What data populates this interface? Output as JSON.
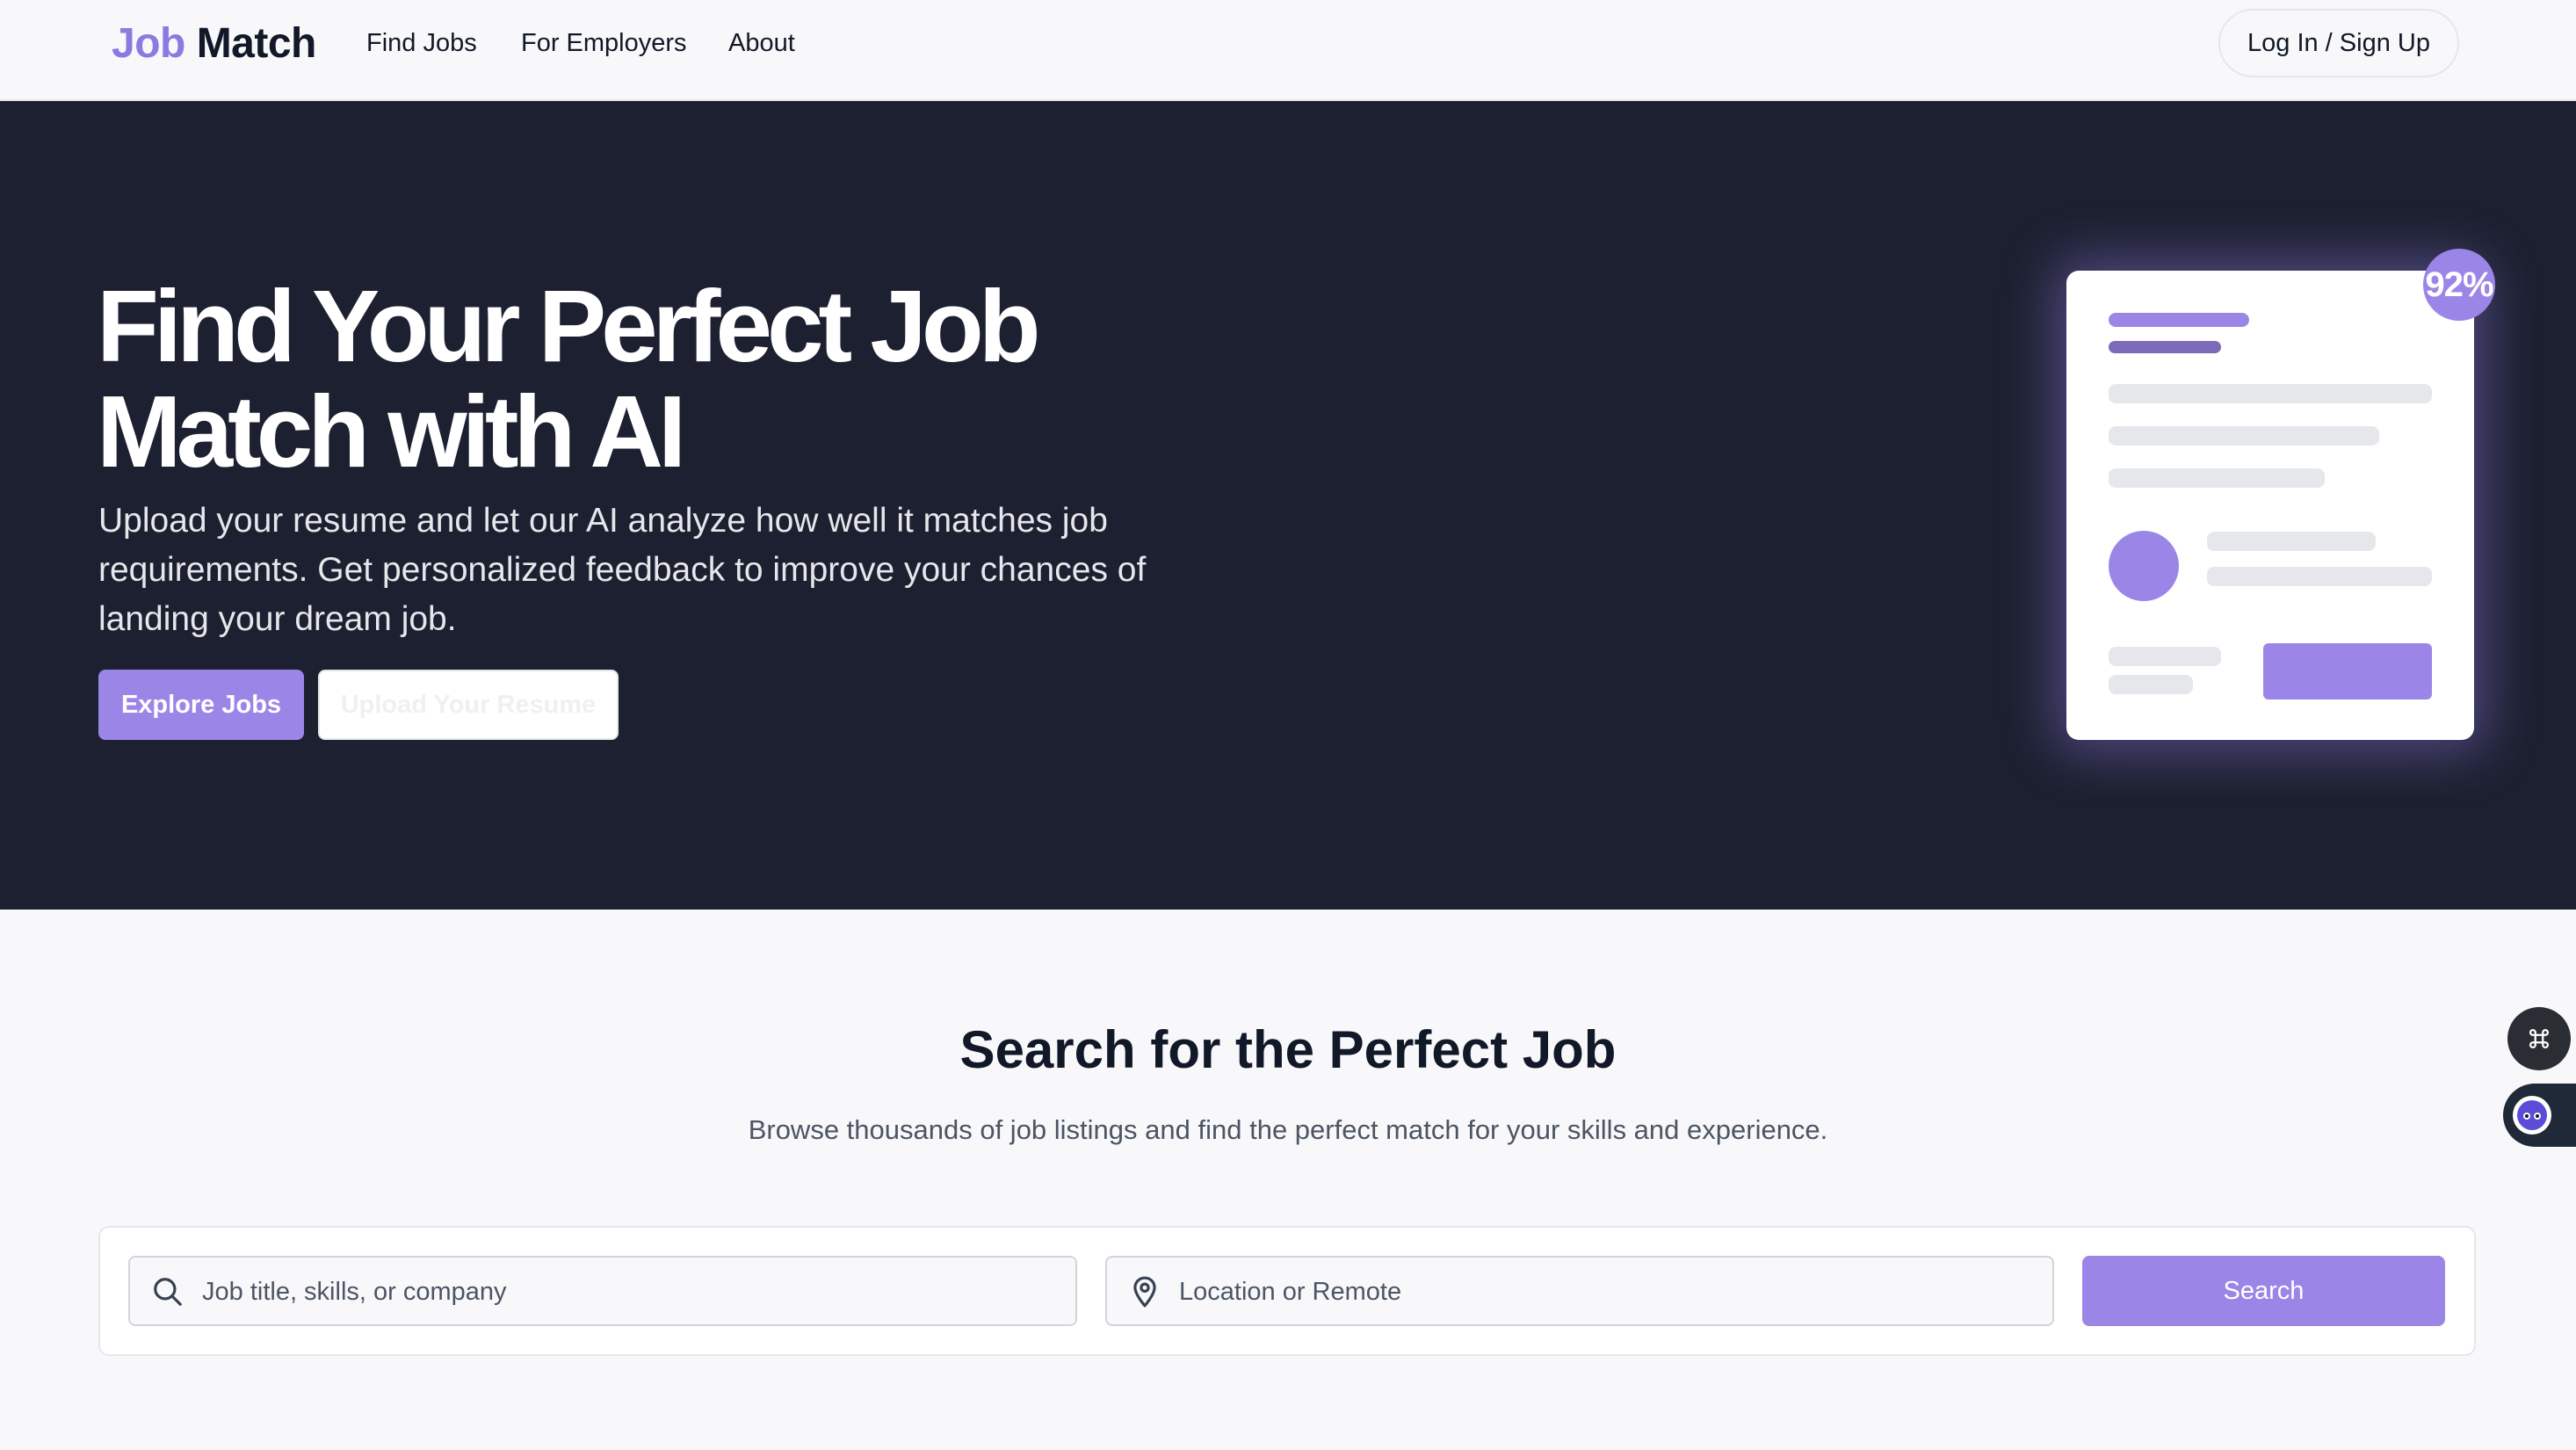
{
  "brand": {
    "logo_part1": "Job",
    "logo_part2": "Match",
    "accent": "#9b86e8"
  },
  "nav": {
    "links": [
      "Find Jobs",
      "For Employers",
      "About"
    ],
    "login_label": "Log In / Sign Up"
  },
  "hero": {
    "title_line1": "Find Your Perfect Job",
    "title_line2": "Match with AI",
    "subtitle": "Upload your resume and let our AI analyze how well it matches job requirements. Get personalized feedback to improve your chances of landing your dream job.",
    "primary_button": "Explore Jobs",
    "secondary_button": "Upload Your Resume",
    "match_badge": "92%",
    "background": "#1d2030"
  },
  "search_section": {
    "title": "Search for the Perfect Job",
    "subtitle": "Browse thousands of job listings and find the perfect match for your skills and experience.",
    "keyword_placeholder": "Job title, skills, or company",
    "location_placeholder": "Location or Remote",
    "search_button": "Search"
  },
  "widgets": {
    "command_icon": "command-icon",
    "assistant_icon": "bot-icon"
  }
}
